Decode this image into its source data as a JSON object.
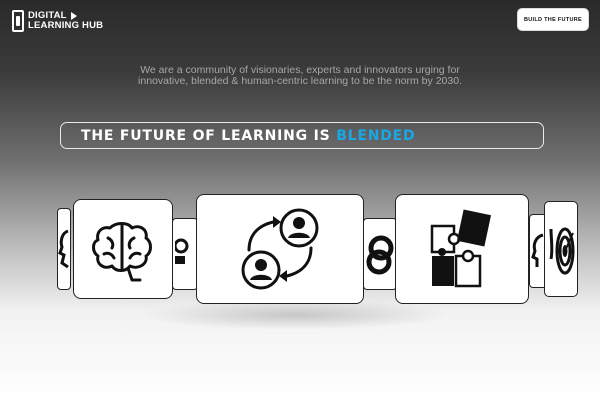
{
  "brand": {
    "line1": "DIGITAL",
    "line2": "LEARNING HUB",
    "logo_icon": "book-play-logo"
  },
  "cta": {
    "label": "BUILD THE FUTURE"
  },
  "tagline": "We are a community of visionaries, experts and innovators urging for innovative, blended & human-centric learning to be the norm by 2030.",
  "headline": {
    "prefix": "THE FUTURE OF LEARNING IS ",
    "accent": "BLENDED",
    "accent_color": "#1aa7e8"
  },
  "carousel": {
    "cards": [
      {
        "icon": "head-icon"
      },
      {
        "icon": "brain-icon"
      },
      {
        "icon": "partial-figure-icon"
      },
      {
        "icon": "exchange-people-icon"
      },
      {
        "icon": "rings-icon"
      },
      {
        "icon": "puzzle-icon"
      },
      {
        "icon": "partial-head-icon"
      },
      {
        "icon": "target-icon"
      }
    ]
  }
}
